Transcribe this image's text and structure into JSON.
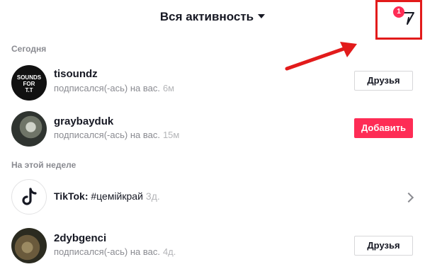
{
  "header": {
    "title": "Вся активность",
    "filter_badge": "1"
  },
  "sections": {
    "today": "Сегодня",
    "this_week": "На этой неделе"
  },
  "notifications": [
    {
      "username": "tisoundz",
      "action": "подписался(-ась) на вас.",
      "time": "6м",
      "button": "Друзья",
      "avatar_text": [
        "SOUNDS",
        "FOR",
        "T.T"
      ]
    },
    {
      "username": "graybayduk",
      "action": "подписался(-ась) на вас.",
      "time": "15м",
      "button": "Добавить"
    },
    {
      "sender": "TikTok:",
      "hashtag": "#цемійкрай",
      "time": "3д."
    },
    {
      "username": "2dybgenci",
      "action": "подписался(-ась) на вас.",
      "time": "4д.",
      "button": "Друзья"
    }
  ],
  "colors": {
    "accent": "#fe2c55",
    "highlight": "#e21b1b",
    "muted": "#8a8b91"
  },
  "icons": {
    "filter": "filter-icon",
    "chevron": "chevron-right-icon",
    "caret": "caret-down-icon"
  }
}
